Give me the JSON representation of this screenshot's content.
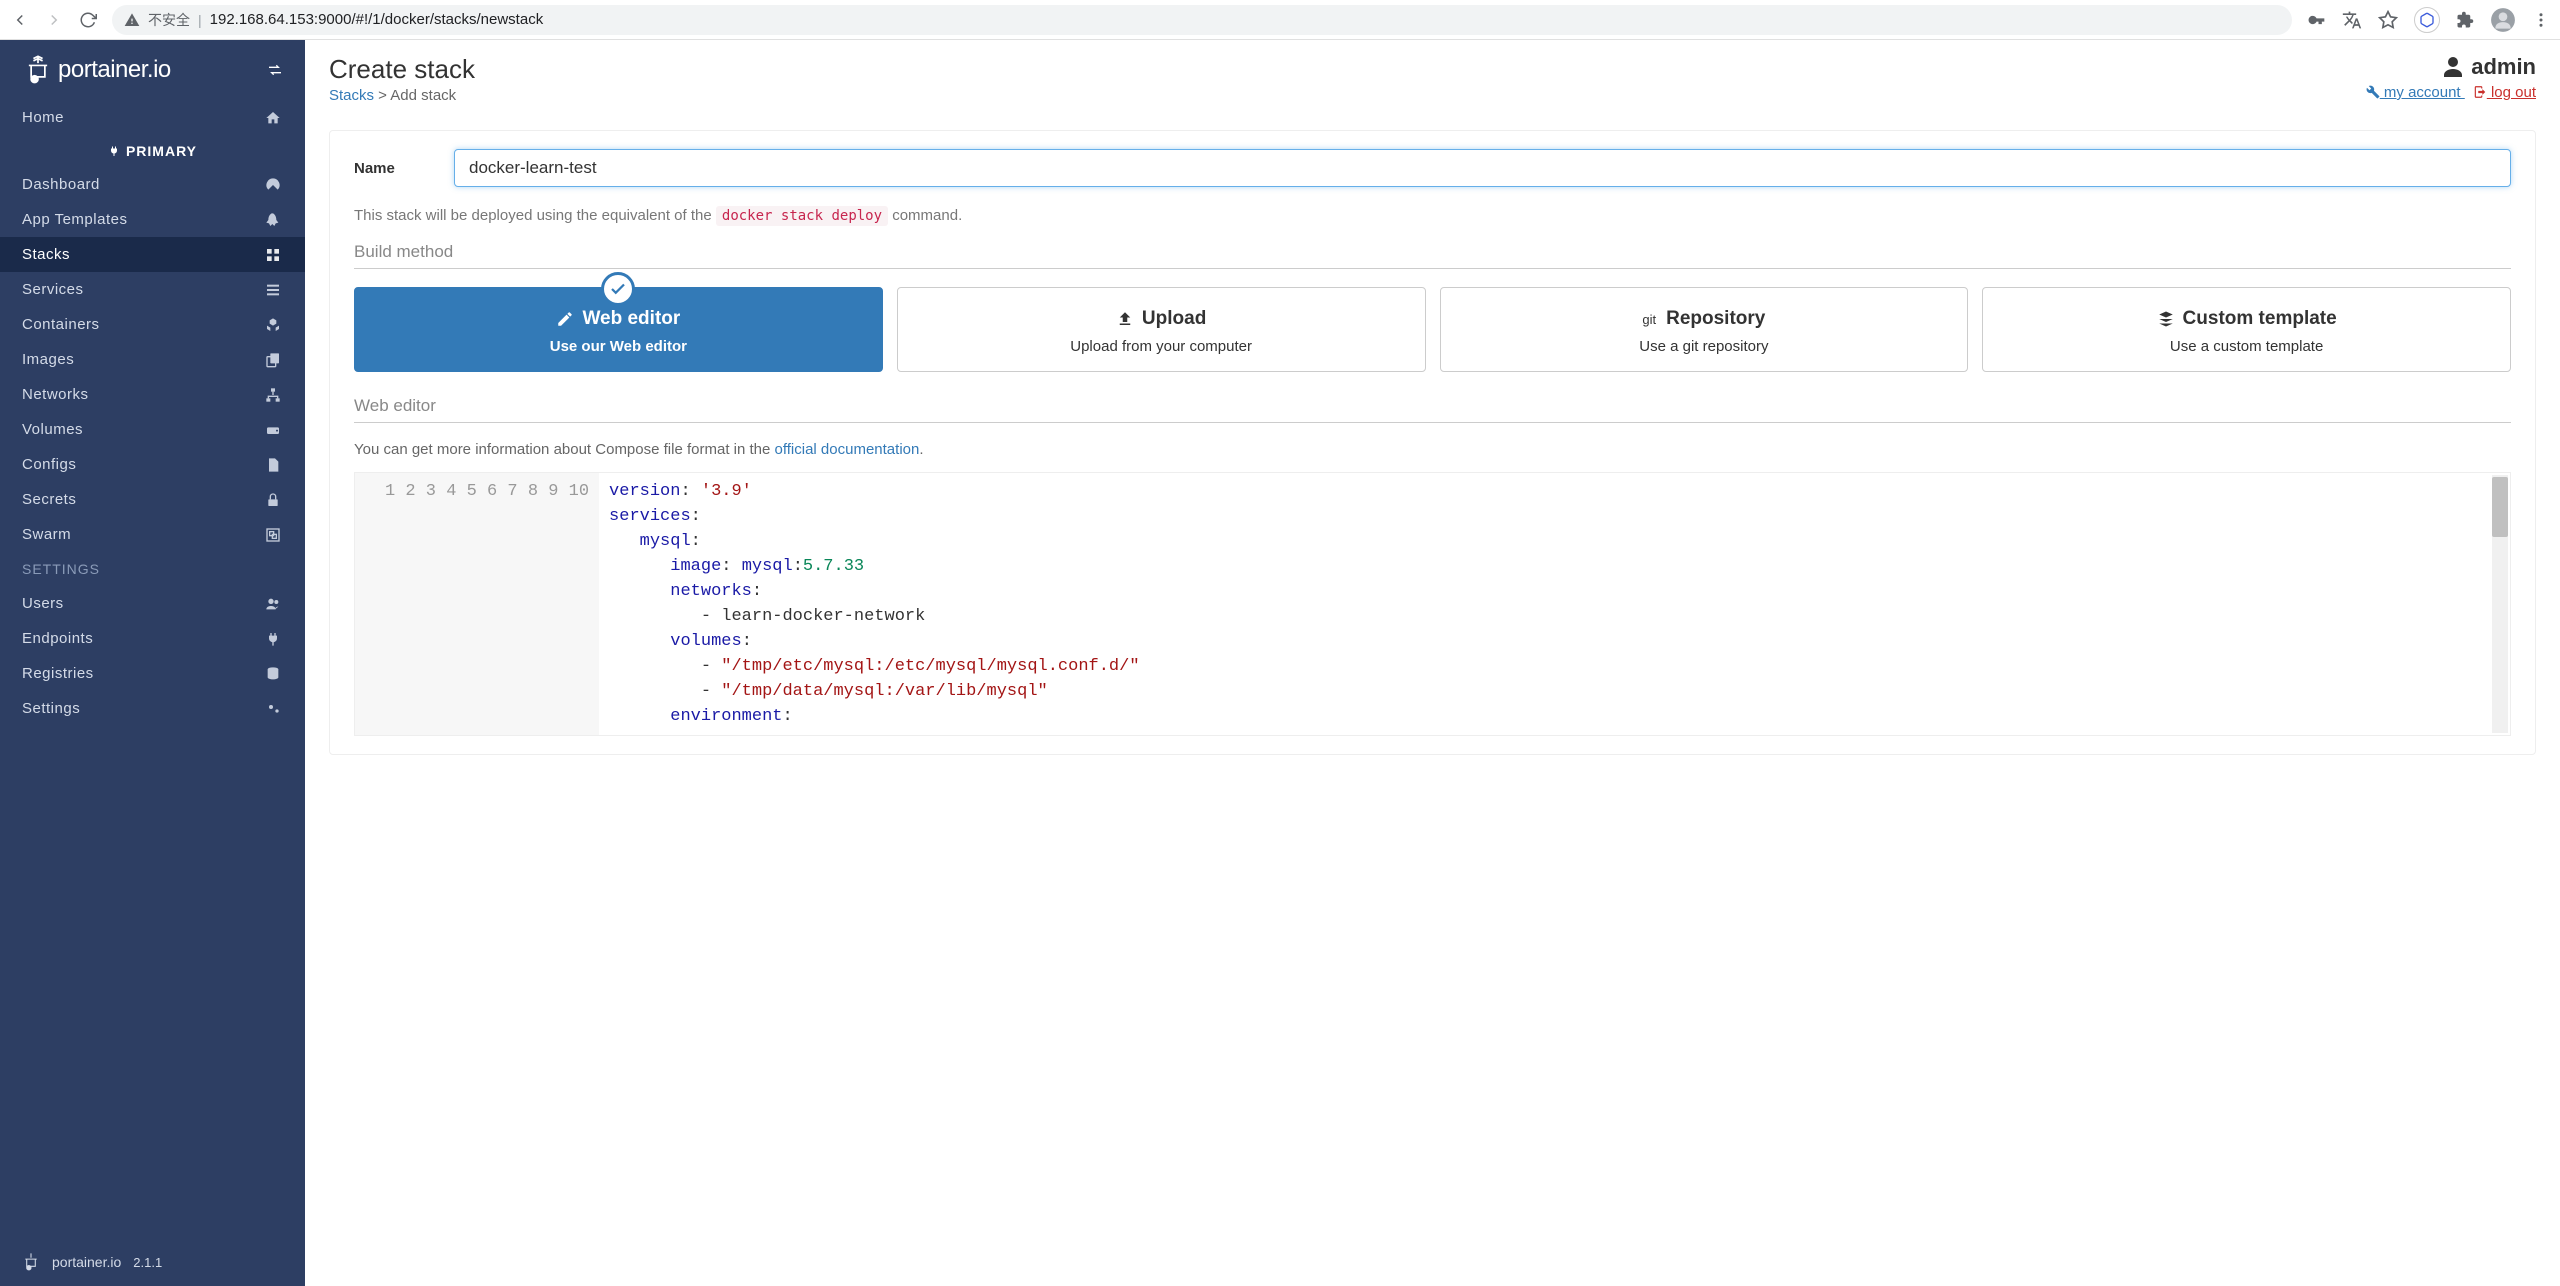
{
  "browser": {
    "insecure_label": "不安全",
    "url": "192.168.64.153:9000/#!/1/docker/stacks/newstack"
  },
  "sidebar": {
    "logo": "portainer.io",
    "primary_label": "PRIMARY",
    "items_top": [
      {
        "label": "Home",
        "icon": "home"
      }
    ],
    "items": [
      {
        "label": "Dashboard",
        "icon": "dashboard"
      },
      {
        "label": "App Templates",
        "icon": "rocket"
      },
      {
        "label": "Stacks",
        "icon": "th",
        "active": true
      },
      {
        "label": "Services",
        "icon": "list"
      },
      {
        "label": "Containers",
        "icon": "cubes"
      },
      {
        "label": "Images",
        "icon": "clone"
      },
      {
        "label": "Networks",
        "icon": "sitemap"
      },
      {
        "label": "Volumes",
        "icon": "hdd"
      },
      {
        "label": "Configs",
        "icon": "file"
      },
      {
        "label": "Secrets",
        "icon": "lock"
      },
      {
        "label": "Swarm",
        "icon": "object-group"
      }
    ],
    "settings_header": "SETTINGS",
    "settings": [
      {
        "label": "Users",
        "icon": "users"
      },
      {
        "label": "Endpoints",
        "icon": "plug"
      },
      {
        "label": "Registries",
        "icon": "database"
      },
      {
        "label": "Settings",
        "icon": "cogs"
      }
    ],
    "footer_logo": "portainer.io",
    "version": "2.1.1"
  },
  "header": {
    "title": "Create stack",
    "breadcrumb_link": "Stacks",
    "breadcrumb_sep": " > ",
    "breadcrumb_current": "Add stack",
    "user": "admin",
    "my_account": " my account ",
    "logout": " log out"
  },
  "form": {
    "name_label": "Name",
    "name_value": "docker-learn-test",
    "help_pre": "This stack will be deployed using the equivalent of the ",
    "help_code": "docker stack deploy",
    "help_post": " command.",
    "build_method_title": "Build method",
    "methods": [
      {
        "title": "Web editor",
        "sub": "Use our Web editor",
        "active": true
      },
      {
        "title": "Upload",
        "sub": "Upload from your computer"
      },
      {
        "title": "Repository",
        "sub": "Use a git repository",
        "prefix": "git"
      },
      {
        "title": "Custom template",
        "sub": "Use a custom template"
      }
    ],
    "web_editor_title": "Web editor",
    "editor_help_pre": "You can get more information about Compose file format in the ",
    "editor_help_link": "official documentation",
    "editor_help_post": "."
  },
  "editor": {
    "lines": [
      [
        {
          "t": "version",
          "c": "key"
        },
        {
          "t": ": ",
          "c": ""
        },
        {
          "t": "'3.9'",
          "c": "str"
        }
      ],
      [
        {
          "t": "services",
          "c": "key"
        },
        {
          "t": ":",
          "c": ""
        }
      ],
      [
        {
          "t": "   ",
          "c": ""
        },
        {
          "t": "mysql",
          "c": "key"
        },
        {
          "t": ":",
          "c": ""
        }
      ],
      [
        {
          "t": "      ",
          "c": ""
        },
        {
          "t": "image",
          "c": "key"
        },
        {
          "t": ": ",
          "c": ""
        },
        {
          "t": "mysql",
          "c": "key"
        },
        {
          "t": ":",
          "c": ""
        },
        {
          "t": "5.7.33",
          "c": "n"
        }
      ],
      [
        {
          "t": "      ",
          "c": ""
        },
        {
          "t": "networks",
          "c": "key"
        },
        {
          "t": ":",
          "c": ""
        }
      ],
      [
        {
          "t": "         - ",
          "c": ""
        },
        {
          "t": "learn-docker-network",
          "c": ""
        }
      ],
      [
        {
          "t": "      ",
          "c": ""
        },
        {
          "t": "volumes",
          "c": "key"
        },
        {
          "t": ":",
          "c": ""
        }
      ],
      [
        {
          "t": "         - ",
          "c": ""
        },
        {
          "t": "\"/tmp/etc/mysql:/etc/mysql/mysql.conf.d/\"",
          "c": "str"
        }
      ],
      [
        {
          "t": "         - ",
          "c": ""
        },
        {
          "t": "\"/tmp/data/mysql:/var/lib/mysql\"",
          "c": "str"
        }
      ],
      [
        {
          "t": "      ",
          "c": ""
        },
        {
          "t": "environment",
          "c": "key"
        },
        {
          "t": ":",
          "c": ""
        }
      ]
    ]
  }
}
